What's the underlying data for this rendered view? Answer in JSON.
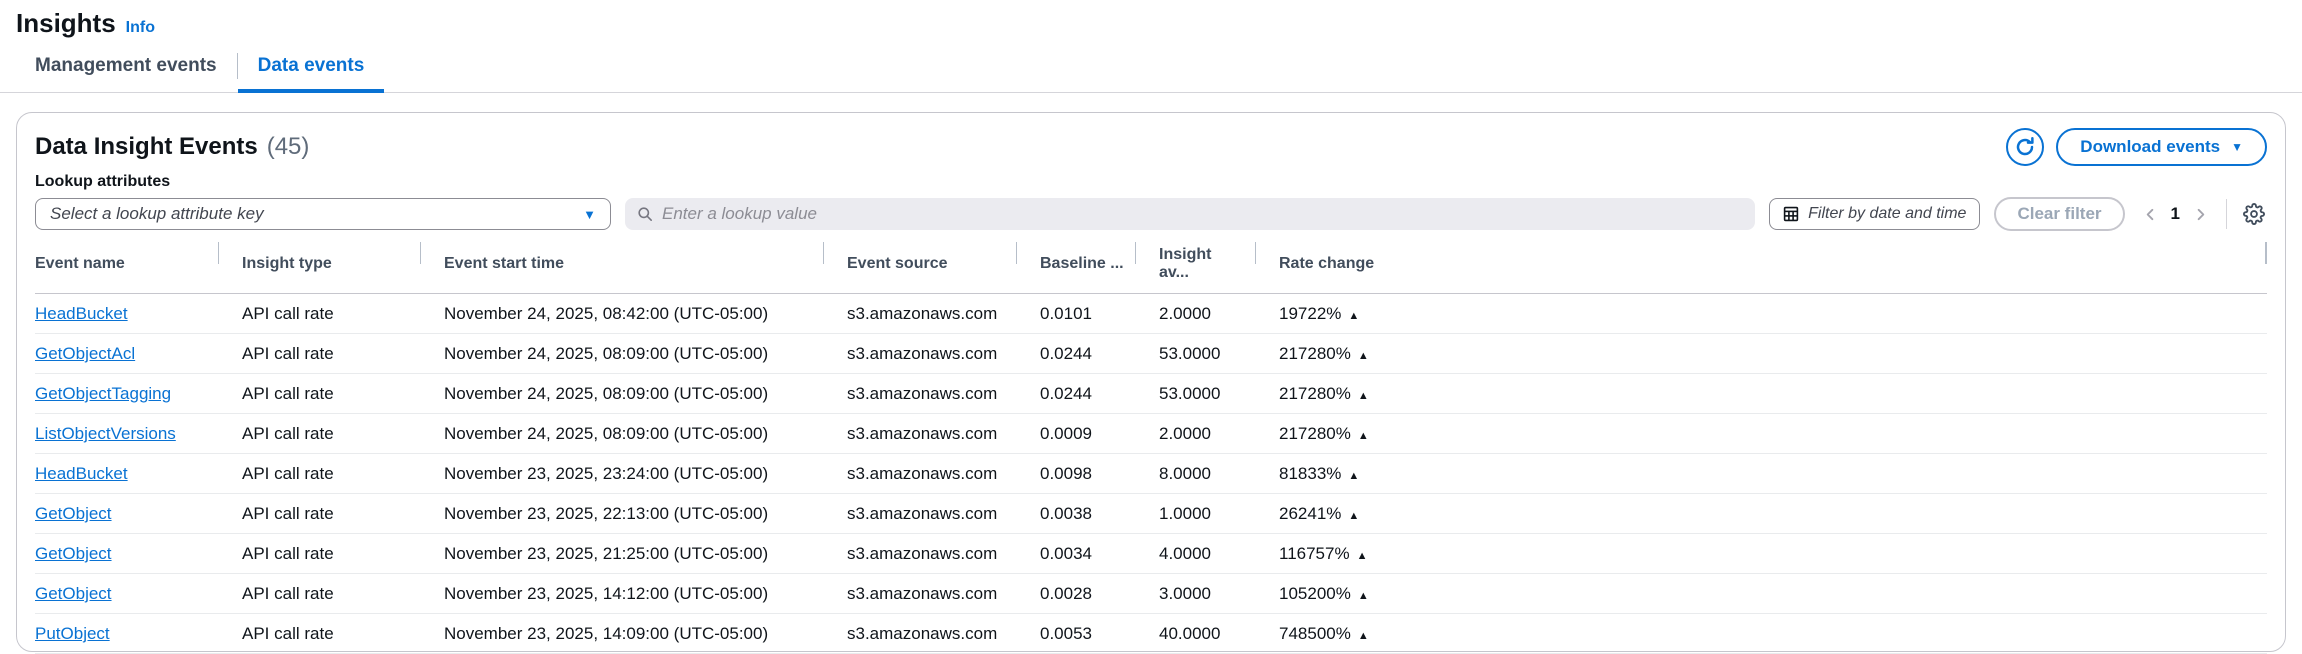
{
  "page": {
    "title": "Insights",
    "info_label": "Info"
  },
  "tabs": [
    {
      "label": "Management events",
      "active": false
    },
    {
      "label": "Data events",
      "active": true
    }
  ],
  "panel": {
    "title": "Data Insight Events",
    "count": "(45)",
    "download_button": "Download events",
    "lookup_label": "Lookup attributes",
    "attribute_select_placeholder": "Select a lookup attribute key",
    "search_placeholder": "Enter a lookup value",
    "date_filter_placeholder": "Filter by date and time",
    "clear_filter_label": "Clear filter",
    "pagination": {
      "current_page": "1"
    }
  },
  "icons": {
    "refresh": "circular-arrow",
    "caret_down": "▼",
    "search": "magnifier",
    "calendar": "grid-calendar",
    "prev_page": "chevron-left",
    "next_page": "chevron-right",
    "settings": "gear",
    "rate_up": "▲"
  },
  "colors": {
    "accent_blue": "#0972d3",
    "text_dark": "#0f141a",
    "text_slate": "#414d5c",
    "text_gray": "#5f6b7a",
    "disabled_text": "#9ba7b6",
    "card_border": "#c6c6cd",
    "input_border": "#8c8c94",
    "row_divider": "#e9ebed",
    "search_bg": "#ebebf0"
  },
  "table": {
    "columns": [
      "Event name",
      "Insight type",
      "Event start time",
      "Event source",
      "Baseline ...",
      "Insight av...",
      "Rate change"
    ],
    "rows": [
      {
        "event_name": "HeadBucket",
        "insight_type": "API call rate",
        "start_time": "November 24, 2025, 08:42:00 (UTC-05:00)",
        "source": "s3.amazonaws.com",
        "baseline": "0.0101",
        "insight_avg": "2.0000",
        "rate_change": "19722%"
      },
      {
        "event_name": "GetObjectAcl",
        "insight_type": "API call rate",
        "start_time": "November 24, 2025, 08:09:00 (UTC-05:00)",
        "source": "s3.amazonaws.com",
        "baseline": "0.0244",
        "insight_avg": "53.0000",
        "rate_change": "217280%"
      },
      {
        "event_name": "GetObjectTagging",
        "insight_type": "API call rate",
        "start_time": "November 24, 2025, 08:09:00 (UTC-05:00)",
        "source": "s3.amazonaws.com",
        "baseline": "0.0244",
        "insight_avg": "53.0000",
        "rate_change": "217280%"
      },
      {
        "event_name": "ListObjectVersions",
        "insight_type": "API call rate",
        "start_time": "November 24, 2025, 08:09:00 (UTC-05:00)",
        "source": "s3.amazonaws.com",
        "baseline": "0.0009",
        "insight_avg": "2.0000",
        "rate_change": "217280%"
      },
      {
        "event_name": "HeadBucket",
        "insight_type": "API call rate",
        "start_time": "November 23, 2025, 23:24:00 (UTC-05:00)",
        "source": "s3.amazonaws.com",
        "baseline": "0.0098",
        "insight_avg": "8.0000",
        "rate_change": "81833%"
      },
      {
        "event_name": "GetObject",
        "insight_type": "API call rate",
        "start_time": "November 23, 2025, 22:13:00 (UTC-05:00)",
        "source": "s3.amazonaws.com",
        "baseline": "0.0038",
        "insight_avg": "1.0000",
        "rate_change": "26241%"
      },
      {
        "event_name": "GetObject",
        "insight_type": "API call rate",
        "start_time": "November 23, 2025, 21:25:00 (UTC-05:00)",
        "source": "s3.amazonaws.com",
        "baseline": "0.0034",
        "insight_avg": "4.0000",
        "rate_change": "116757%"
      },
      {
        "event_name": "GetObject",
        "insight_type": "API call rate",
        "start_time": "November 23, 2025, 14:12:00 (UTC-05:00)",
        "source": "s3.amazonaws.com",
        "baseline": "0.0028",
        "insight_avg": "3.0000",
        "rate_change": "105200%"
      },
      {
        "event_name": "PutObject",
        "insight_type": "API call rate",
        "start_time": "November 23, 2025, 14:09:00 (UTC-05:00)",
        "source": "s3.amazonaws.com",
        "baseline": "0.0053",
        "insight_avg": "40.0000",
        "rate_change": "748500%"
      }
    ]
  }
}
